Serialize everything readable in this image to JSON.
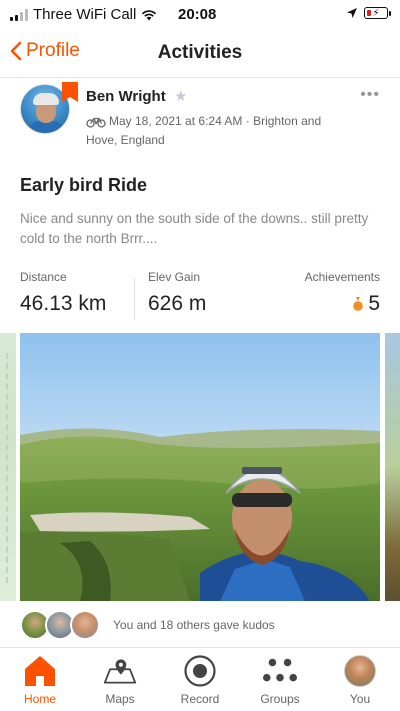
{
  "status_bar": {
    "carrier": "Three WiFi Call",
    "time": "20:08",
    "icons": [
      "signal-icon",
      "wifi-icon",
      "location-arrow-icon",
      "battery-low-charging-icon"
    ]
  },
  "nav": {
    "back_label": "Profile",
    "title": "Activities"
  },
  "activity": {
    "athlete_name": "Ben Wright",
    "meta": "May 18, 2021 at 6:24 AM · Brighton and Hove, England",
    "title": "Early bird Ride",
    "description": "Nice and sunny on the south side of the downs.. still pretty cold to the north Brrr....",
    "stats": [
      {
        "label": "Distance",
        "value": "46.13 km"
      },
      {
        "label": "Elev Gain",
        "value": "626 m"
      },
      {
        "label": "Achievements",
        "value": "5"
      }
    ]
  },
  "kudos": {
    "text": "You and 18 others gave kudos"
  },
  "tabs": [
    {
      "label": "Home",
      "icon": "home-icon",
      "active": true
    },
    {
      "label": "Maps",
      "icon": "map-pin-icon",
      "active": false
    },
    {
      "label": "Record",
      "icon": "record-icon",
      "active": false
    },
    {
      "label": "Groups",
      "icon": "groups-icon",
      "active": false
    },
    {
      "label": "You",
      "icon": "profile-avatar-icon",
      "active": false
    }
  ],
  "colors": {
    "accent": "#fc5200",
    "text_primary": "#222222",
    "text_secondary": "#666666"
  }
}
